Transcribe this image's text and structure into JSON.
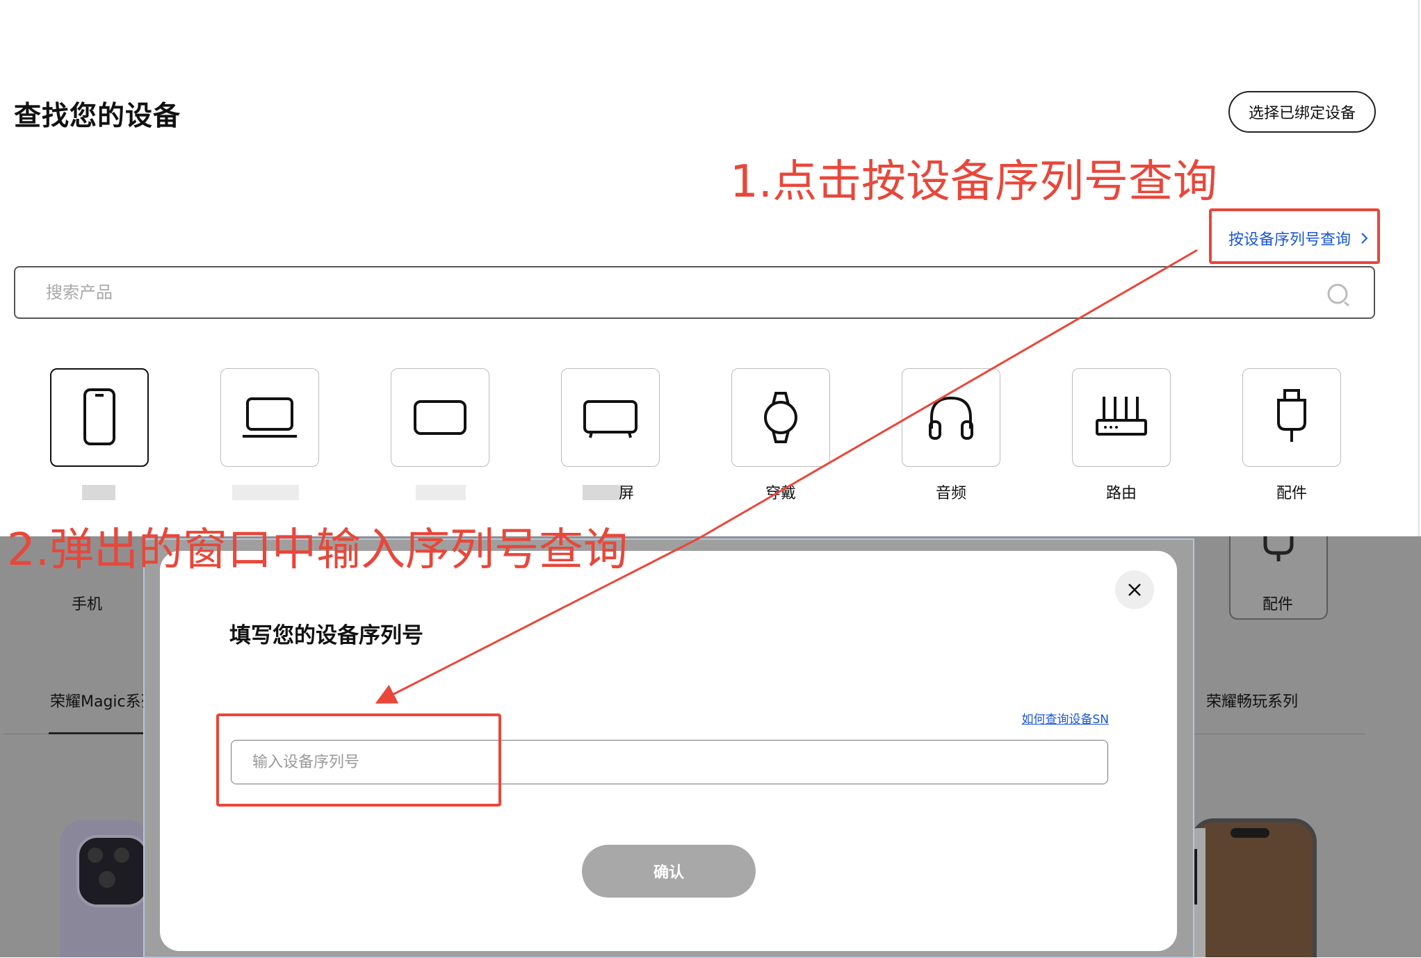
{
  "page": {
    "title": "查找您的设备",
    "bound_button": "选择已绑定设备",
    "sn_link": "按设备序列号查询",
    "search": {
      "placeholder": "搜索产品"
    },
    "categories": [
      {
        "label": "",
        "icon": "phone-icon"
      },
      {
        "label": "",
        "icon": "laptop-icon"
      },
      {
        "label": "",
        "icon": "tablet-icon"
      },
      {
        "label": "屏",
        "icon": "monitor-icon"
      },
      {
        "label": "穿戴",
        "icon": "watch-icon"
      },
      {
        "label": "音频",
        "icon": "headphones-icon"
      },
      {
        "label": "路由",
        "icon": "router-icon"
      },
      {
        "label": "配件",
        "icon": "charger-icon"
      }
    ]
  },
  "background_page": {
    "phone_label": "手机",
    "accessory_label": "配件",
    "series_left": "荣耀Magic系列",
    "series_right": "荣耀畅玩系列"
  },
  "annotations": {
    "step1": "1.点击按设备序列号查询",
    "step2": "2.弹出的窗口中输入序列号查询",
    "color": "#e8473a"
  },
  "modal": {
    "title": "填写您的设备序列号",
    "help_link": "如何查询设备SN",
    "input_placeholder": "输入设备序列号",
    "confirm": "确认"
  },
  "colors": {
    "link": "#1a56d8",
    "confirm_disabled": "#a8a8a8",
    "overlay": "#8f8f8f"
  }
}
